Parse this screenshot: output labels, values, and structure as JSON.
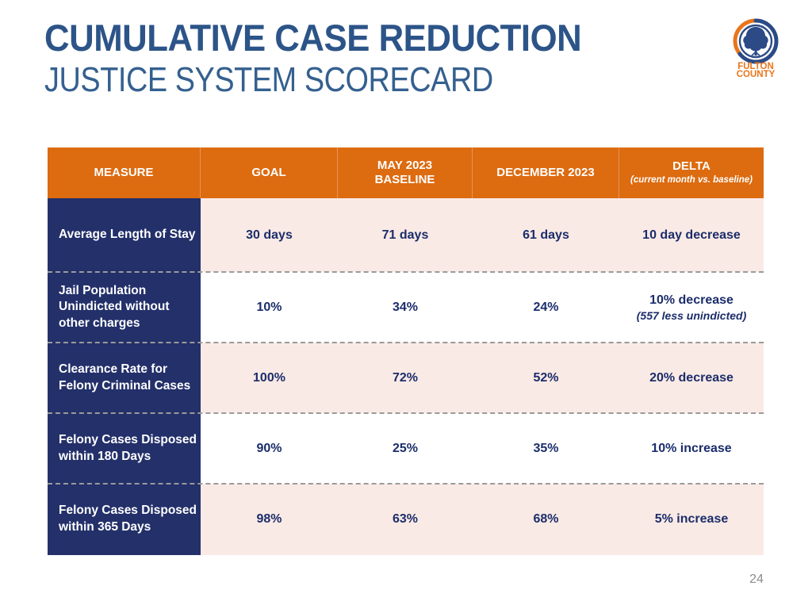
{
  "slide": {
    "title_main": "CUMULATIVE CASE REDUCTION",
    "title_sub": "JUSTICE SYSTEM SCORECARD",
    "page_number": "24",
    "colors": {
      "title_blue": "#2C5488",
      "header_orange": "#DD6B10",
      "measure_navy": "#23306A",
      "row_tint": "#FAEAE5",
      "value_navy": "#1B2D6B",
      "page_number_gray": "#8C8C8C"
    }
  },
  "logo": {
    "name": "fulton-county-logo",
    "line1": "FULTON",
    "line2": "COUNTY"
  },
  "table": {
    "headers": [
      {
        "label": "MEASURE"
      },
      {
        "label": "GOAL"
      },
      {
        "label": "MAY 2023\nBASELINE"
      },
      {
        "label": "DECEMBER 2023"
      },
      {
        "label": "DELTA",
        "sub": "(current month vs. baseline)"
      }
    ],
    "rows": [
      {
        "measure": "Average Length of Stay",
        "goal": "30 days",
        "baseline": "71 days",
        "december": "61 days",
        "delta": "10 day decrease",
        "delta_sub": ""
      },
      {
        "measure": "Jail Population Unindicted without other charges",
        "goal": "10%",
        "baseline": "34%",
        "december": "24%",
        "delta": "10% decrease",
        "delta_sub": "(557 less unindicted)"
      },
      {
        "measure": "Clearance Rate for Felony Criminal Cases",
        "goal": "100%",
        "baseline": "72%",
        "december": "52%",
        "delta": "20% decrease",
        "delta_sub": ""
      },
      {
        "measure": "Felony Cases Disposed within 180 Days",
        "goal": "90%",
        "baseline": "25%",
        "december": "35%",
        "delta": "10% increase",
        "delta_sub": ""
      },
      {
        "measure": "Felony Cases Disposed within 365 Days",
        "goal": "98%",
        "baseline": "63%",
        "december": "68%",
        "delta": "5% increase",
        "delta_sub": ""
      }
    ]
  }
}
